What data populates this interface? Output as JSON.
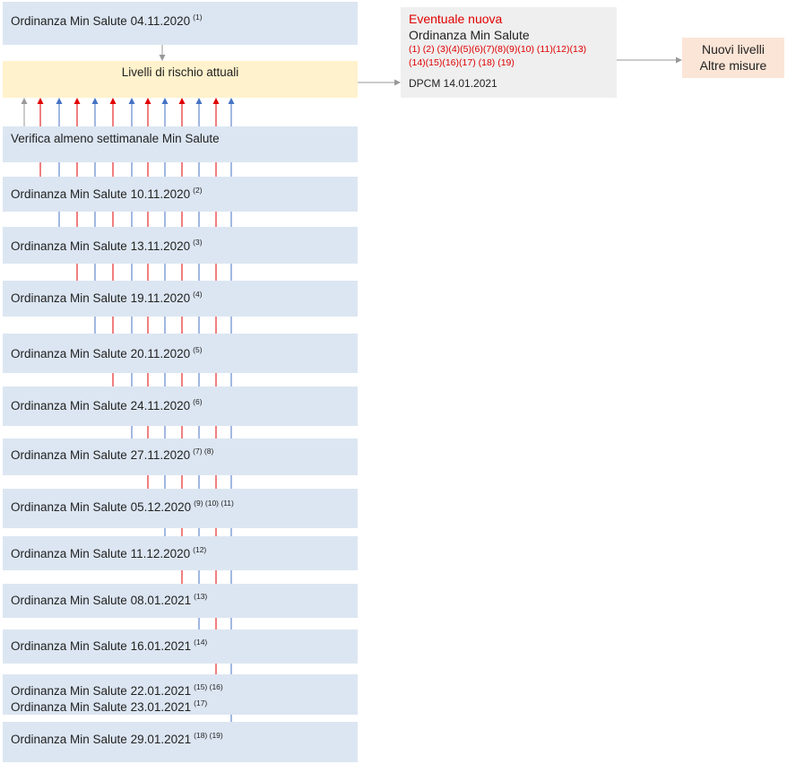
{
  "colors": {
    "box_blue": "#dce6f2",
    "box_yellow": "#fff2cc",
    "box_grey": "#efefef",
    "box_peach": "#fbe5d6",
    "line_red": "#e00000",
    "line_blue": "#4472c4",
    "line_grey": "#999999"
  },
  "ordinances": [
    {
      "text": "Ordinanza Min Salute 04.11.2020",
      "notes": "(1)"
    },
    {
      "text": "Ordinanza Min Salute 10.11.2020",
      "notes": "(2)"
    },
    {
      "text": "Ordinanza Min Salute 13.11.2020",
      "notes": "(3)"
    },
    {
      "text": "Ordinanza Min Salute 19.11.2020",
      "notes": "(4)"
    },
    {
      "text": "Ordinanza Min Salute 20.11.2020",
      "notes": "(5)"
    },
    {
      "text": "Ordinanza Min Salute 24.11.2020",
      "notes": "(6)"
    },
    {
      "text": "Ordinanza Min Salute 27.11.2020",
      "notes": "(7) (8)"
    },
    {
      "text": "Ordinanza Min Salute 05.12.2020",
      "notes": "(9) (10) (11)"
    },
    {
      "text": "Ordinanza Min Salute 11.12.2020",
      "notes": "(12)"
    },
    {
      "text": "Ordinanza Min Salute 08.01.2021",
      "notes": "(13)"
    },
    {
      "text": "Ordinanza Min Salute 16.01.2021",
      "notes": "(14)"
    },
    {
      "text": "Ordinanza Min Salute 22.01.2021",
      "notes": "(15) (16)"
    },
    {
      "text": "Ordinanza Min Salute 23.01.2021",
      "notes": "(17)"
    },
    {
      "text": "Ordinanza Min Salute 29.01.2021",
      "notes": "(18) (19)"
    }
  ],
  "risk_box": {
    "text": "Livelli di rischio attuali"
  },
  "weekly_box": {
    "text": "Verifica almeno settimanale Min Salute"
  },
  "new_box": {
    "title": "Eventuale nuova",
    "subtitle": "Ordinanza Min Salute",
    "refs_line1": "(1) (2) (3)(4)(5)(6)(7)(8)(9)(10) (11)(12)(13)",
    "refs_line2": "(14)(15)(16)(17) (18) (19)",
    "dpcm": "DPCM 14.01.2021"
  },
  "levels_box": {
    "line1": "Nuovi livelli",
    "line2": "Altre misure"
  }
}
